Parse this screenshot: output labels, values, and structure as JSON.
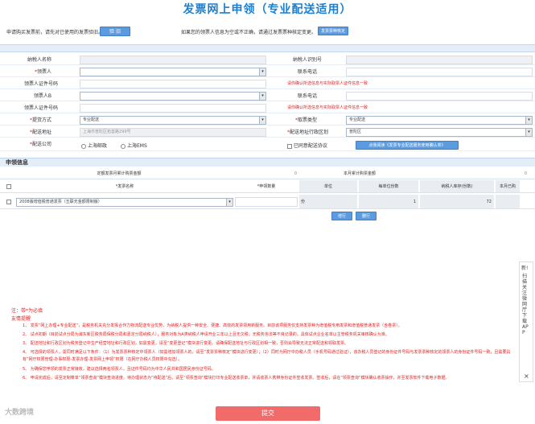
{
  "page": {
    "title": "发票网上申领（专业配送适用）",
    "notice_left": "申请购买发票前，请先对已使用的发票验旧。",
    "verify_button": "验 旧",
    "notice_right": "如果您的领票人信息为空或不正确，请通过发票票种核定变更。",
    "change_button": "发票票种核定"
  },
  "form": {
    "taxpayer_name_label": "纳税人名称",
    "taxpayer_id_label": "纳税人识别号",
    "taxpayer_name_value": "",
    "taxpayer_id_value": "",
    "recipient_label": "领票人",
    "contact_phone_label": "联系电话",
    "recipient_id_label": "领票人证件号码",
    "recipient_warning": "请你确认所选信息与实际取票人证件信息一致",
    "recipient_b_label": "领票人B",
    "contact_phone_b_label": "联系电话",
    "recipient_b_id_label": "领票人证件号码",
    "recipient_b_warning": "请你确认所选信息与实际取票人证件信息一致",
    "delivery_method_label": "提货方式",
    "delivery_method_value": "专业配送",
    "ticket_type_label": "取票类型",
    "ticket_type_value": "专业配送",
    "delivery_address_label": "配送地址",
    "delivery_address_value": "上海市普陀区拓善路299号",
    "delivery_district_label": "配送地址行政区划",
    "delivery_district_value": "普陀区",
    "delivery_company_label": "配送公司",
    "company_option_1": "上海邮政",
    "company_option_2": "上海EMS",
    "agree_label": "已同意配送协议",
    "agreement_button": "点我阅读《发票专业配送服务使用确认单》"
  },
  "invoice": {
    "section_title": "申领信息",
    "monthly_limit_label": "定额发票月累计购票金额",
    "monthly_limit_value": "0",
    "monthly_total_label": "本月累计购票金额",
    "monthly_total_value": "0",
    "columns": [
      "*发票名称",
      "*申领数量",
      "单位",
      "每单位份数",
      "纳税人库存(份数)",
      "本月已购"
    ],
    "row": {
      "name": "2008版增值税普通发票（五联无金额限制版）",
      "quantity": "",
      "unit": "份",
      "per_unit": "1",
      "stock": "72"
    },
    "add_row_button": "增行",
    "delete_row_button": "删行"
  },
  "notes": {
    "required_hint": "注：带*为必填",
    "tips_title": "友情提醒",
    "items": [
      "1、 发票“网上办理+专业配送”，是税务机关充分发挥合作力物流配送专业优势，为纳税人提供一种安全、便捷、高效的发票领用新服务。目前该项服务仅支持发票种为增值税专用发票和增值税普通发票（含卷票）。",
      "2、 试点初期（目前试点分局为浦东新区税务局保税分局和嘉定分局纳税人），服务对象为A类纳税人申请开业三年以上且无欠税，无税务违法等不良记录的，具体试点企业名单以主管税务机关审核确认为准。",
      "3、 配送地址和行政区划为税务登记中生产经营地址和行政区划，如需变更，请至“变更登记”模块进行变更。请确保配送地址与行政区划相一致，否则会导致无法正常配送和领取发票。",
      "4、 可选择的领票人，需同时满足以下条件：（1）为发票票种核定中领票人（如需增加领票人的，请至“发票票种核定”模块进行变更）；（2）同时为网厅中办税人员（手机号码通过验证），该办税人员登记的身份证件号码与发票票种核定的领票人的身份证件号码一致，且需要具有“网厅权限管理-办事权限-发票办理-发票网上申领”权限（在网厅办税人员权限中勾选）。",
      "5、 为确保您申领的发票正常接收，建议选择两名领票人，且证件号码均为中华人民共和国居民身份证号码。",
      "6、 申请完成后，请至定制菜单“领票查询”模块查询进度。待办理状态为“待配送”后，请至“领票查询”模块打印专业配送收票单，并请收票人携带身份证件签收发票。签收后，请在“领票查询”模块确认收票操作，并至发票软件下载电子数据。"
    ]
  },
  "footer": {
    "submit_button": "提交",
    "watermark": "大数跨境"
  },
  "side": {
    "new_label": "新!",
    "app_promo": "扫描关注微网厅 下载APP",
    "close_label": "×"
  },
  "colors": {
    "title_blue": "#1a7fd1",
    "button_blue": "#5b9be0",
    "warning_red": "#e52020",
    "submit_red": "#f16b6b",
    "section_bg": "#e4eef8"
  }
}
